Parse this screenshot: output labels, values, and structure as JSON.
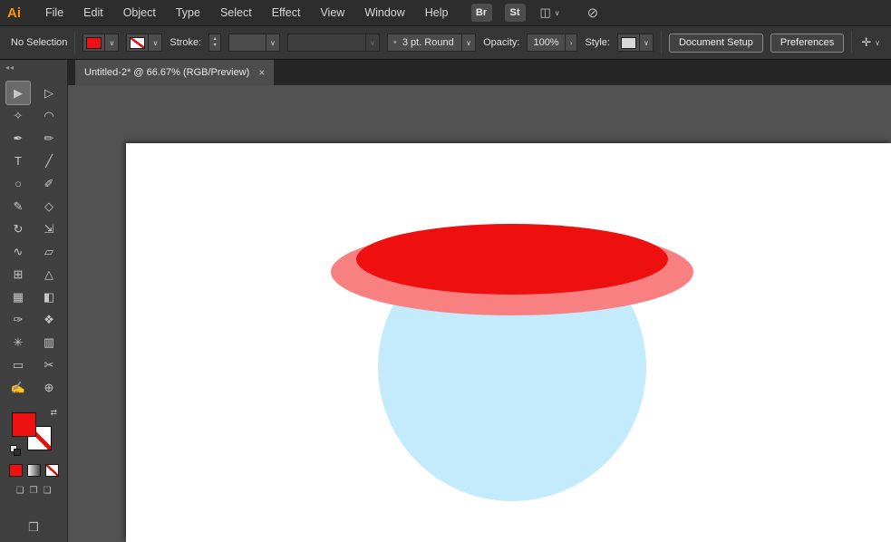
{
  "icons": {
    "chevron_down": "∨",
    "chevron_right": "›",
    "up_arrow": "▴",
    "down_arrow": "▾",
    "collapse": "◂◂",
    "close": "×",
    "swap": "⇄",
    "arrange_documents": "◫",
    "sync": "⊘",
    "workspace": "✛",
    "brush_dot": "•",
    "draw_normal": "❏",
    "draw_behind": "❐",
    "draw_inside": "❑",
    "screen_mode": "❐"
  },
  "menubar": {
    "logo": "Ai",
    "items": [
      "File",
      "Edit",
      "Object",
      "Type",
      "Select",
      "Effect",
      "View",
      "Window",
      "Help"
    ],
    "badges": [
      "Br",
      "St"
    ]
  },
  "controlbar": {
    "selection_status": "No Selection",
    "fill_color": "#ee1111",
    "stroke_label": "Stroke:",
    "brush_value": "3 pt. Round",
    "opacity_label": "Opacity:",
    "opacity_value": "100%",
    "style_label": "Style:",
    "document_setup_label": "Document Setup",
    "preferences_label": "Preferences"
  },
  "tab": {
    "title": "Untitled-2* @ 66.67% (RGB/Preview)"
  },
  "toolbar": {
    "fill_color": "#ee1111",
    "tools": [
      {
        "name": "selection-tool",
        "glyph": "▶"
      },
      {
        "name": "direct-selection-tool",
        "glyph": "▷"
      },
      {
        "name": "magic-wand-tool",
        "glyph": "✧"
      },
      {
        "name": "lasso-tool",
        "glyph": "◠"
      },
      {
        "name": "pen-tool",
        "glyph": "✒"
      },
      {
        "name": "curvature-tool",
        "glyph": "✏"
      },
      {
        "name": "type-tool",
        "glyph": "T"
      },
      {
        "name": "line-segment-tool",
        "glyph": "╱"
      },
      {
        "name": "ellipse-tool",
        "glyph": "○"
      },
      {
        "name": "paintbrush-tool",
        "glyph": "✐"
      },
      {
        "name": "pencil-tool",
        "glyph": "✎"
      },
      {
        "name": "eraser-tool",
        "glyph": "◇"
      },
      {
        "name": "rotate-tool",
        "glyph": "↻"
      },
      {
        "name": "scale-tool",
        "glyph": "⇲"
      },
      {
        "name": "width-tool",
        "glyph": "∿"
      },
      {
        "name": "free-transform-tool",
        "glyph": "▱"
      },
      {
        "name": "shape-builder-tool",
        "glyph": "⊞"
      },
      {
        "name": "perspective-grid-tool",
        "glyph": "△"
      },
      {
        "name": "mesh-tool",
        "glyph": "▦"
      },
      {
        "name": "gradient-tool",
        "glyph": "◧"
      },
      {
        "name": "eyedropper-tool",
        "glyph": "✑"
      },
      {
        "name": "blend-tool",
        "glyph": "❖"
      },
      {
        "name": "symbol-sprayer-tool",
        "glyph": "✳"
      },
      {
        "name": "column-graph-tool",
        "glyph": "▥"
      },
      {
        "name": "artboard-tool",
        "glyph": "▭"
      },
      {
        "name": "slice-tool",
        "glyph": "✂"
      },
      {
        "name": "hand-tool",
        "glyph": "✍"
      },
      {
        "name": "zoom-tool",
        "glyph": "⊕"
      }
    ]
  },
  "canvas": {
    "head_color": "#c3ebfc",
    "brim_color": "#f98080",
    "crown_color": "#ee0f0f"
  }
}
